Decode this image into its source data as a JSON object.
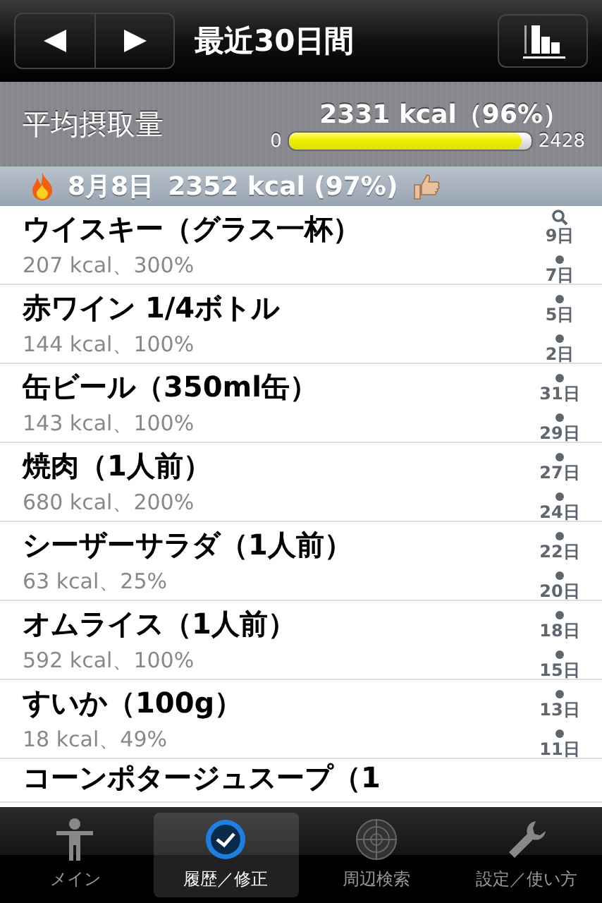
{
  "nav": {
    "title": "最近30日間"
  },
  "summary": {
    "label": "平均摂取量",
    "value": "2331 kcal（96%）",
    "min": "0",
    "max": "2428",
    "level": 0.96
  },
  "day_header": {
    "date": "8月8日",
    "total": "2352 kcal (97%)"
  },
  "items": [
    {
      "name": "ウイスキー（グラス一杯）",
      "detail": "207 kcal、300%"
    },
    {
      "name": "赤ワイン 1/4ボトル",
      "detail": "144 kcal、100%"
    },
    {
      "name": "缶ビール（350ml缶）",
      "detail": "143 kcal、100%"
    },
    {
      "name": "焼肉（1人前）",
      "detail": "680 kcal、200%"
    },
    {
      "name": "シーザーサラダ（1人前）",
      "detail": "63 kcal、25%"
    },
    {
      "name": "オムライス（1人前）",
      "detail": "592 kcal、100%"
    },
    {
      "name": "すいか（100g）",
      "detail": "18 kcal、49%"
    },
    {
      "name": "コーンポタージュスープ（1"
    }
  ],
  "index": [
    "9日",
    "7日",
    "5日",
    "2日",
    "31日",
    "29日",
    "27日",
    "24日",
    "22日",
    "20日",
    "18日",
    "15日",
    "13日",
    "11日"
  ],
  "tabs": [
    {
      "label": "メイン",
      "selected": false
    },
    {
      "label": "履歴／修正",
      "selected": true
    },
    {
      "label": "周辺検索",
      "selected": false
    },
    {
      "label": "設定／使い方",
      "selected": false
    }
  ]
}
